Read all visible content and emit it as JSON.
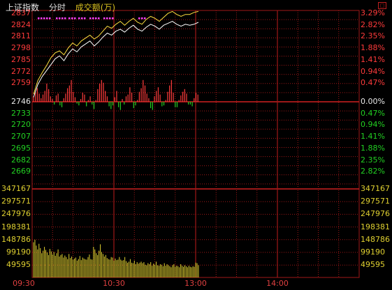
{
  "header": {
    "title": "上证指数",
    "mode": "分时",
    "volume_label": "成交额(万)"
  },
  "window_button": "□",
  "price_axis": {
    "prev_close": "2746",
    "above": [
      "2837",
      "2824",
      "2811",
      "2798",
      "2785",
      "2772",
      "2759"
    ],
    "below": [
      "2733",
      "2720",
      "2707",
      "2695",
      "2682",
      "2669"
    ]
  },
  "pct_axis": {
    "zero": "0.00%",
    "above": [
      "3.29%",
      "2.82%",
      "2.35%",
      "1.88%",
      "1.41%",
      "0.94%",
      "0.47%"
    ],
    "below": [
      "0.47%",
      "0.94%",
      "1.41%",
      "1.88%",
      "2.35%",
      "2.82%"
    ]
  },
  "volume_axis": [
    "347167",
    "297571",
    "247976",
    "198381",
    "148786",
    "99190",
    "49595"
  ],
  "time_axis": [
    "09:30",
    "10:30",
    "13:00",
    "14:00"
  ],
  "colors": {
    "up": "#ff3b3b",
    "down": "#22d022",
    "grid": "#a01818",
    "price_line": "#ffffff",
    "avg_line": "#ffe040",
    "volume": "#e0d030",
    "marker": "#ff40ff"
  },
  "chart_data": {
    "type": "line",
    "prev_close": 2746,
    "price_range": [
      2656,
      2837
    ],
    "volume_range": [
      0,
      347167
    ],
    "elapsed_minutes": 122,
    "total_minutes": 240,
    "series": [
      {
        "values": [
          2749,
          2762,
          2770,
          2776,
          2782,
          2788,
          2791,
          2786,
          2793,
          2798,
          2795,
          2800,
          2803,
          2806,
          2801,
          2805,
          2810,
          2814,
          2812,
          2816,
          2818,
          2815,
          2819,
          2822,
          2818,
          2816,
          2820,
          2823,
          2821,
          2818,
          2822,
          2824,
          2826,
          2823,
          2821,
          2823,
          2822,
          2823,
          2825
        ]
      },
      {
        "values": [
          2752,
          2766,
          2774,
          2781,
          2789,
          2794,
          2796,
          2792,
          2799,
          2804,
          2801,
          2806,
          2809,
          2812,
          2808,
          2811,
          2816,
          2821,
          2819,
          2823,
          2826,
          2822,
          2826,
          2829,
          2825,
          2823,
          2828,
          2831,
          2829,
          2826,
          2830,
          2834,
          2836,
          2833,
          2831,
          2833,
          2833,
          2835,
          2836
        ]
      }
    ],
    "breadth_bars": [
      6,
      10,
      15,
      9,
      4,
      8,
      12,
      20,
      14,
      6,
      3,
      -3,
      7,
      9,
      -4,
      -6,
      4,
      9,
      15,
      18,
      24,
      11,
      5,
      -2,
      -4,
      3,
      10,
      8,
      -5,
      2,
      6,
      -3,
      -8,
      2,
      14,
      20,
      24,
      21,
      12,
      6,
      -5,
      -8,
      -4,
      5,
      12,
      -6,
      -9,
      3,
      -3,
      6,
      8,
      16,
      10,
      -7,
      -4,
      2,
      11,
      15,
      24,
      18,
      9,
      4,
      -7,
      -9,
      6,
      12,
      16,
      8,
      -5,
      -4,
      2,
      11,
      18,
      24,
      10,
      -6,
      -6,
      2,
      7,
      11,
      14,
      9,
      -3,
      -3,
      -5,
      4,
      10,
      8
    ],
    "volume_values": [
      138000,
      148000,
      125000,
      110000,
      132000,
      115000,
      95000,
      105000,
      120000,
      108000,
      98000,
      88000,
      112000,
      102000,
      90000,
      100000,
      85000,
      95000,
      110000,
      82000,
      88000,
      92000,
      78000,
      86000,
      80000,
      72000,
      92000,
      76000,
      82000,
      70000,
      74000,
      78000,
      66000,
      72000,
      84000,
      68000,
      78000,
      74000,
      71000,
      70000,
      80000,
      90000,
      72000,
      70000,
      120000,
      110000,
      95000,
      88000,
      105000,
      130000,
      100000,
      92000,
      82000,
      88000,
      76000,
      72000,
      70000,
      80000,
      78000,
      66000,
      74000,
      68000,
      70000,
      80000,
      70000,
      66000,
      68000,
      80000,
      64000,
      58000,
      62000,
      72000,
      58000,
      56000,
      66000,
      52000,
      60000,
      54000,
      58000,
      62000,
      56000,
      60000,
      50000,
      48000,
      56000,
      52000,
      60000,
      46000,
      54000,
      50000,
      62000,
      48000,
      46000,
      52000,
      50000,
      44000,
      56000,
      46000,
      52000,
      48000,
      44000,
      40000,
      48000,
      52000,
      42000,
      46000,
      44000,
      40000,
      52000,
      46000,
      42000,
      48000,
      44000,
      40000,
      46000,
      42000,
      40000,
      44000,
      42000,
      58000,
      56000,
      48000
    ]
  }
}
